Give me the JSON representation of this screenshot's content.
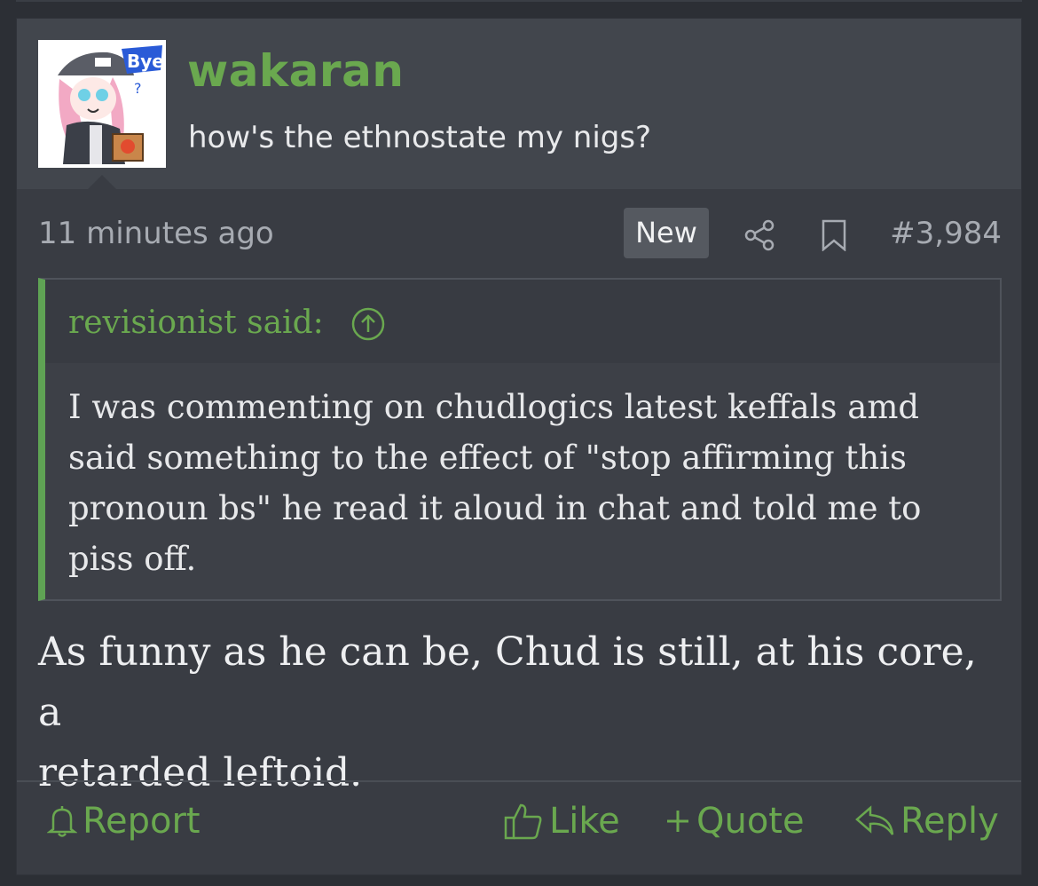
{
  "post": {
    "username": "wakaran",
    "user_title": "how's the ethnostate my nigs?",
    "avatar_badge_text": "Bye",
    "time": "11 minutes ago",
    "badge": "New",
    "post_number": "#3,984",
    "quote": {
      "author": "revisionist said:",
      "text": "I was commenting on chudlogics latest keffals amd\nsaid something to the effect of \"stop affirming this\npronoun bs\" he read it aloud in chat and told me to\npiss off."
    },
    "message": "As funny as he can be, Chud is still, at his core, a\nretarded leftoid.",
    "actions": {
      "report": "Report",
      "like": "Like",
      "quote": "Quote",
      "reply": "Reply"
    }
  },
  "colors": {
    "accent": "#6aa84f",
    "quote_bar": "#5fa354",
    "background": "#2c2f35",
    "post_bg": "#393c43"
  },
  "icons": [
    "share-icon",
    "bookmark-icon",
    "arrow-up-circle-icon",
    "bell-icon",
    "thumbs-up-icon",
    "plus-icon",
    "reply-icon"
  ]
}
